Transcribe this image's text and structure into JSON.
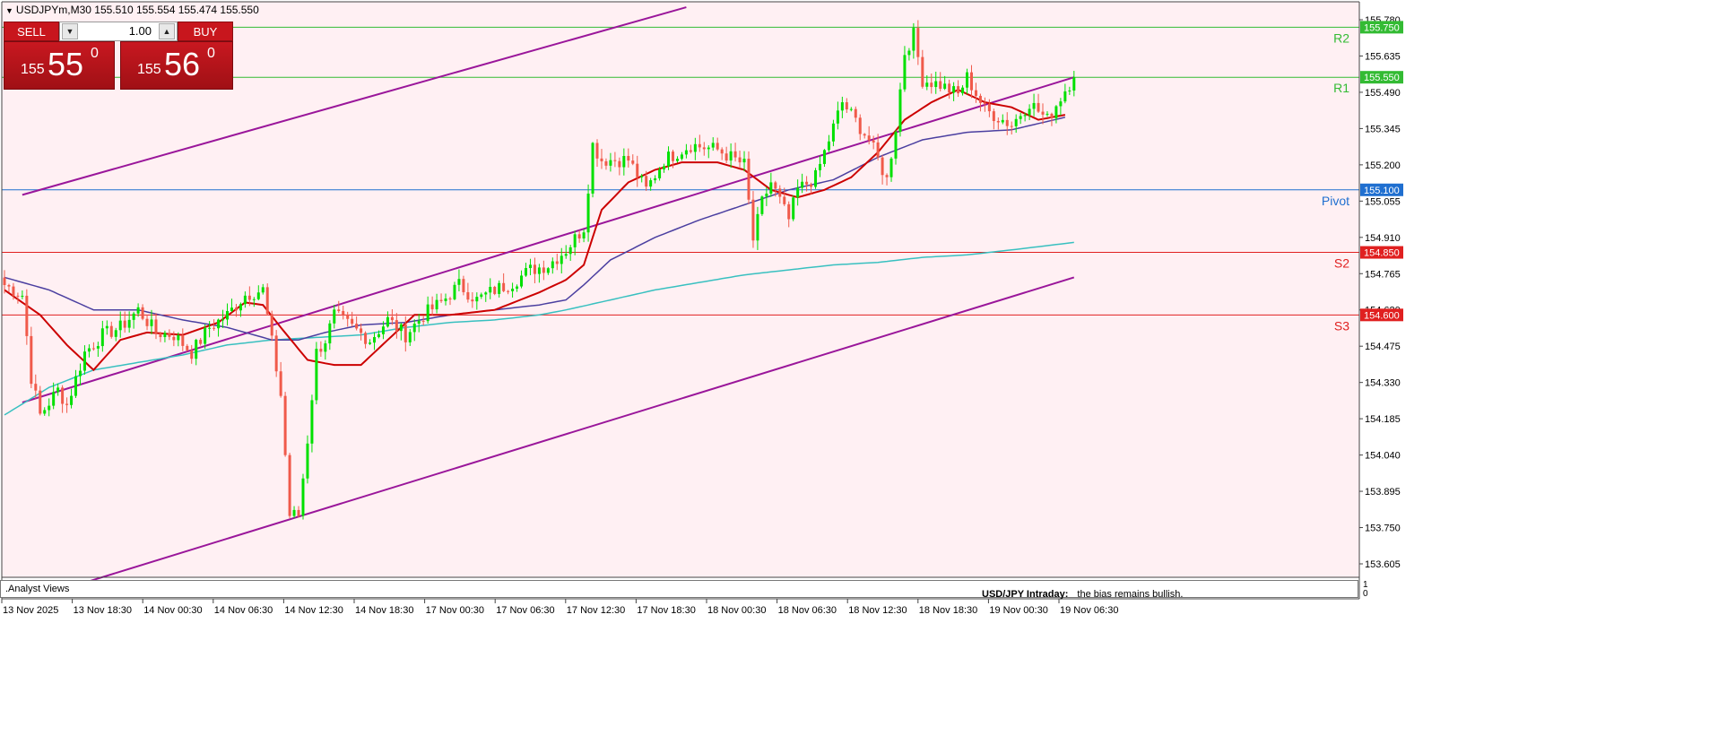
{
  "header": {
    "symbol_line": "USDJPYm,M30  155.510 155.554 155.474 155.550"
  },
  "trade_panel": {
    "sell_label": "SELL",
    "buy_label": "BUY",
    "lot_value": "1.00",
    "sell_small": "155",
    "sell_big": "55",
    "sell_pip": "0",
    "buy_small": "155",
    "buy_big": "56",
    "buy_pip": "0"
  },
  "indicator_panel": {
    "title": ".Analyst Views",
    "scale_max": "1",
    "scale_min": "0",
    "analyst_title": "USD/JPY Intraday:",
    "analyst_text": "the bias remains bullish."
  },
  "colors": {
    "background": "#fff0f3",
    "bull": "#00e000",
    "bear": "#f05a4a",
    "ma_fast": "#cc0000",
    "ma_mid": "#4b3fa0",
    "ma_slow": "#38c0c0",
    "channel": "#9a169a",
    "resistance": "#33bb33",
    "pivot": "#1f6fd0",
    "support": "#e02020"
  },
  "chart_data": {
    "type": "candlestick",
    "ylim": [
      153.53,
      155.81
    ],
    "yticks": [
      "155.780",
      "155.635",
      "155.490",
      "155.345",
      "155.200",
      "155.055",
      "154.910",
      "154.765",
      "154.620",
      "154.475",
      "154.330",
      "154.185",
      "154.040",
      "153.895",
      "153.750",
      "153.605"
    ],
    "xticks": [
      "13 Nov 2025",
      "13 Nov 18:30",
      "14 Nov 00:30",
      "14 Nov 06:30",
      "14 Nov 12:30",
      "14 Nov 18:30",
      "17 Nov 00:30",
      "17 Nov 06:30",
      "17 Nov 12:30",
      "17 Nov 18:30",
      "18 Nov 00:30",
      "18 Nov 06:30",
      "18 Nov 12:30",
      "18 Nov 18:30",
      "19 Nov 00:30",
      "19 Nov 06:30"
    ],
    "levels": [
      {
        "name": "R2",
        "value": 155.75,
        "label": "155.750",
        "kind": "resistance"
      },
      {
        "name": "R1",
        "value": 155.55,
        "label": "155.550",
        "kind": "resistance"
      },
      {
        "name": "Pivot",
        "value": 155.1,
        "label": "155.100",
        "kind": "pivot"
      },
      {
        "name": "S2",
        "value": 154.85,
        "label": "154.850",
        "kind": "support"
      },
      {
        "name": "S3",
        "value": 154.6,
        "label": "154.600",
        "kind": "support"
      }
    ],
    "channel": {
      "upper": [
        [
          4,
          155.08
        ],
        [
          153,
          155.83
        ]
      ],
      "middle": [
        [
          4,
          154.25
        ],
        [
          240,
          155.55
        ]
      ],
      "lower": [
        [
          18,
          153.53
        ],
        [
          240,
          154.75
        ]
      ]
    },
    "ma_fast_anchors": [
      [
        0,
        154.7
      ],
      [
        8,
        154.6
      ],
      [
        14,
        154.48
      ],
      [
        20,
        154.38
      ],
      [
        26,
        154.5
      ],
      [
        32,
        154.53
      ],
      [
        40,
        154.52
      ],
      [
        48,
        154.57
      ],
      [
        54,
        154.65
      ],
      [
        58,
        154.64
      ],
      [
        62,
        154.55
      ],
      [
        68,
        154.42
      ],
      [
        74,
        154.4
      ],
      [
        80,
        154.4
      ],
      [
        86,
        154.5
      ],
      [
        92,
        154.6
      ],
      [
        100,
        154.6
      ],
      [
        110,
        154.62
      ],
      [
        120,
        154.69
      ],
      [
        126,
        154.74
      ],
      [
        130,
        154.8
      ],
      [
        134,
        155.02
      ],
      [
        140,
        155.13
      ],
      [
        146,
        155.18
      ],
      [
        152,
        155.21
      ],
      [
        160,
        155.21
      ],
      [
        166,
        155.18
      ],
      [
        172,
        155.1
      ],
      [
        178,
        155.07
      ],
      [
        184,
        155.1
      ],
      [
        190,
        155.15
      ],
      [
        196,
        155.25
      ],
      [
        202,
        155.38
      ],
      [
        208,
        155.45
      ],
      [
        214,
        155.5
      ],
      [
        220,
        155.45
      ],
      [
        226,
        155.43
      ],
      [
        232,
        155.38
      ],
      [
        238,
        155.4
      ]
    ],
    "ma_mid_anchors": [
      [
        0,
        154.75
      ],
      [
        10,
        154.7
      ],
      [
        20,
        154.62
      ],
      [
        30,
        154.62
      ],
      [
        40,
        154.58
      ],
      [
        50,
        154.55
      ],
      [
        60,
        154.5
      ],
      [
        66,
        154.5
      ],
      [
        72,
        154.53
      ],
      [
        80,
        154.56
      ],
      [
        90,
        154.57
      ],
      [
        100,
        154.6
      ],
      [
        110,
        154.62
      ],
      [
        120,
        154.64
      ],
      [
        126,
        154.66
      ],
      [
        130,
        154.72
      ],
      [
        136,
        154.82
      ],
      [
        146,
        154.91
      ],
      [
        156,
        154.98
      ],
      [
        166,
        155.04
      ],
      [
        176,
        155.1
      ],
      [
        186,
        155.14
      ],
      [
        196,
        155.23
      ],
      [
        206,
        155.3
      ],
      [
        216,
        155.33
      ],
      [
        226,
        155.34
      ],
      [
        238,
        155.39
      ]
    ],
    "ma_slow_anchors": [
      [
        0,
        154.2
      ],
      [
        10,
        154.31
      ],
      [
        20,
        154.38
      ],
      [
        30,
        154.41
      ],
      [
        40,
        154.44
      ],
      [
        50,
        154.48
      ],
      [
        60,
        154.5
      ],
      [
        70,
        154.51
      ],
      [
        80,
        154.52
      ],
      [
        90,
        154.55
      ],
      [
        100,
        154.57
      ],
      [
        110,
        154.58
      ],
      [
        120,
        154.6
      ],
      [
        126,
        154.62
      ],
      [
        136,
        154.66
      ],
      [
        146,
        154.7
      ],
      [
        156,
        154.73
      ],
      [
        166,
        154.76
      ],
      [
        176,
        154.78
      ],
      [
        186,
        154.8
      ],
      [
        196,
        154.81
      ],
      [
        206,
        154.83
      ],
      [
        216,
        154.84
      ],
      [
        226,
        154.86
      ],
      [
        240,
        154.89
      ]
    ],
    "price_path": [
      [
        0,
        154.72
      ],
      [
        4,
        154.68
      ],
      [
        6,
        154.35
      ],
      [
        8,
        154.2
      ],
      [
        12,
        154.3
      ],
      [
        14,
        154.24
      ],
      [
        18,
        154.45
      ],
      [
        22,
        154.52
      ],
      [
        26,
        154.55
      ],
      [
        30,
        154.62
      ],
      [
        34,
        154.53
      ],
      [
        38,
        154.52
      ],
      [
        42,
        154.45
      ],
      [
        46,
        154.55
      ],
      [
        50,
        154.6
      ],
      [
        54,
        154.68
      ],
      [
        58,
        154.7
      ],
      [
        62,
        154.28
      ],
      [
        64,
        153.8
      ],
      [
        66,
        153.8
      ],
      [
        68,
        154.1
      ],
      [
        70,
        154.45
      ],
      [
        72,
        154.5
      ],
      [
        74,
        154.6
      ],
      [
        78,
        154.55
      ],
      [
        82,
        154.5
      ],
      [
        86,
        154.58
      ],
      [
        90,
        154.52
      ],
      [
        94,
        154.6
      ],
      [
        98,
        154.65
      ],
      [
        102,
        154.72
      ],
      [
        106,
        154.66
      ],
      [
        110,
        154.7
      ],
      [
        114,
        154.73
      ],
      [
        118,
        154.78
      ],
      [
        122,
        154.8
      ],
      [
        126,
        154.86
      ],
      [
        130,
        154.95
      ],
      [
        132,
        155.28
      ],
      [
        134,
        155.22
      ],
      [
        140,
        155.22
      ],
      [
        144,
        155.1
      ],
      [
        148,
        155.22
      ],
      [
        154,
        155.28
      ],
      [
        160,
        155.26
      ],
      [
        166,
        155.2
      ],
      [
        168,
        154.9
      ],
      [
        170,
        155.05
      ],
      [
        172,
        155.13
      ],
      [
        176,
        154.98
      ],
      [
        178,
        155.1
      ],
      [
        182,
        155.15
      ],
      [
        184,
        155.25
      ],
      [
        188,
        155.45
      ],
      [
        190,
        155.4
      ],
      [
        194,
        155.3
      ],
      [
        198,
        155.14
      ],
      [
        200,
        155.35
      ],
      [
        202,
        155.65
      ],
      [
        204,
        155.72
      ],
      [
        206,
        155.54
      ],
      [
        210,
        155.52
      ],
      [
        214,
        155.48
      ],
      [
        216,
        155.55
      ],
      [
        220,
        155.42
      ],
      [
        224,
        155.38
      ],
      [
        226,
        155.36
      ],
      [
        230,
        155.45
      ],
      [
        234,
        155.38
      ],
      [
        238,
        155.5
      ],
      [
        240,
        155.55
      ]
    ]
  }
}
